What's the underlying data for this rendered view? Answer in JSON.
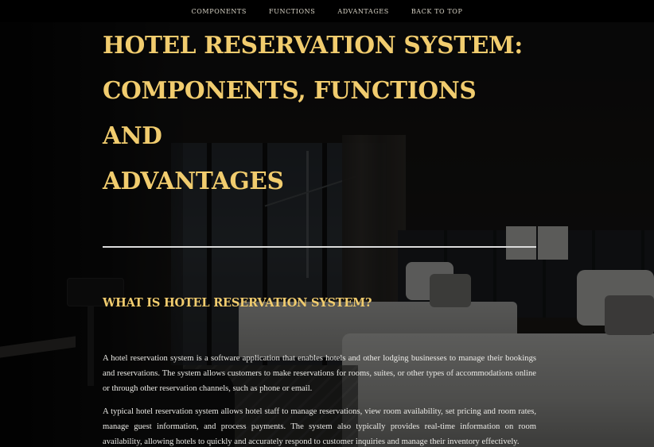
{
  "nav": {
    "items": [
      {
        "label": "COMPONENTS"
      },
      {
        "label": "FUNCTIONS"
      },
      {
        "label": "ADVANTAGES"
      },
      {
        "label": "BACK TO TOP"
      }
    ]
  },
  "hero": {
    "title_lines": [
      "HOTEL RESERVATION SYSTEM:",
      "COMPONENTS, FUNCTIONS AND",
      "ADVANTAGES"
    ]
  },
  "section": {
    "heading": "WHAT IS HOTEL RESERVATION SYSTEM?",
    "paragraphs": [
      "A hotel reservation system is a software application that enables hotels and other lodging businesses to manage their bookings and reservations. The system allows customers to make reservations for rooms, suites, or other types of accommodations online or through other reservation channels, such as phone or email.",
      "A typical hotel reservation system allows hotel staff to manage reservations, view room availability, set pricing and room rates, manage guest information, and process payments. The system also typically provides real-time information on room availability, allowing hotels to quickly and accurately respond to customer inquiries and manage their inventory effectively."
    ]
  },
  "colors": {
    "accent_gold": "#f1cc6e",
    "nav_background": "#000000",
    "body_text": "#ecebe7"
  }
}
